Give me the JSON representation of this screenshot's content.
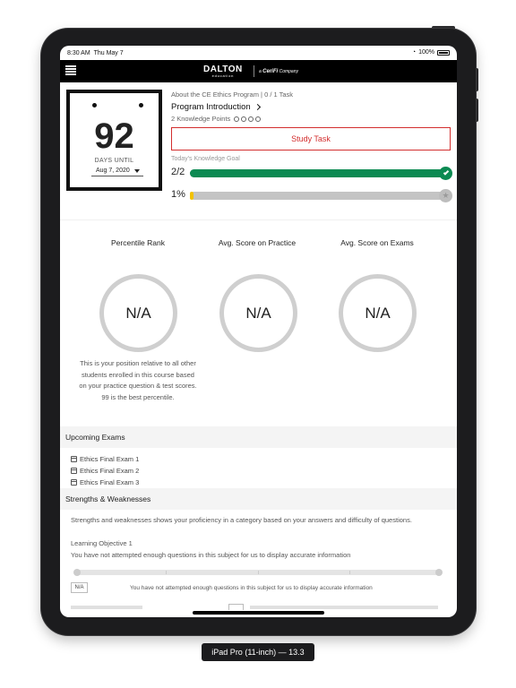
{
  "status_bar": {
    "time": "8:30 AM",
    "date": "Thu May 7",
    "battery": "100%"
  },
  "navbar": {
    "logo_main": "DALTON",
    "logo_sub": "education",
    "company_prefix": "a",
    "company_name": "CeriFi",
    "company_suffix": "Company"
  },
  "countdown": {
    "days": "92",
    "label": "DAYS UNTIL",
    "date": "Aug 7, 2020"
  },
  "program": {
    "meta": "About the CE Ethics Program | 0 / 1 Task",
    "title": "Program Introduction",
    "knowledge_points": "2 Knowledge Points",
    "study_button": "Study Task",
    "goal_label": "Today's Knowledge Goal",
    "goal_fraction": "2/2",
    "goal_progress": 1.0,
    "overall_percent": "1%",
    "overall_progress": 0.01
  },
  "stats": [
    {
      "label": "Percentile Rank",
      "value": "N/A"
    },
    {
      "label": "Avg. Score on Practice",
      "value": "N/A"
    },
    {
      "label": "Avg. Score on Exams",
      "value": "N/A"
    }
  ],
  "percentile_description": "This is your position relative to all other students enrolled in this course based on your practice question & test scores. 99 is the best percentile.",
  "upcoming": {
    "title": "Upcoming Exams",
    "exams": [
      "Ethics Final Exam 1",
      "Ethics Final Exam 2",
      "Ethics Final Exam 3"
    ]
  },
  "strengths": {
    "title": "Strengths & Weaknesses",
    "description": "Strengths and weaknesses shows your proficiency in a category based on your answers and difficulty of questions.",
    "objective_title": "Learning Objective 1",
    "objective_message": "You have not attempted enough questions in this subject for us to display accurate information",
    "badge": "N/A",
    "badge_message": "You have not attempted enough questions in this subject for us to display accurate information"
  },
  "device_label": "iPad Pro (11-inch) — 13.3",
  "colors": {
    "accent_red": "#d32f2f",
    "progress_green": "#0b8a52",
    "trophy_yellow": "#f2c200",
    "navbar": "#000000"
  }
}
